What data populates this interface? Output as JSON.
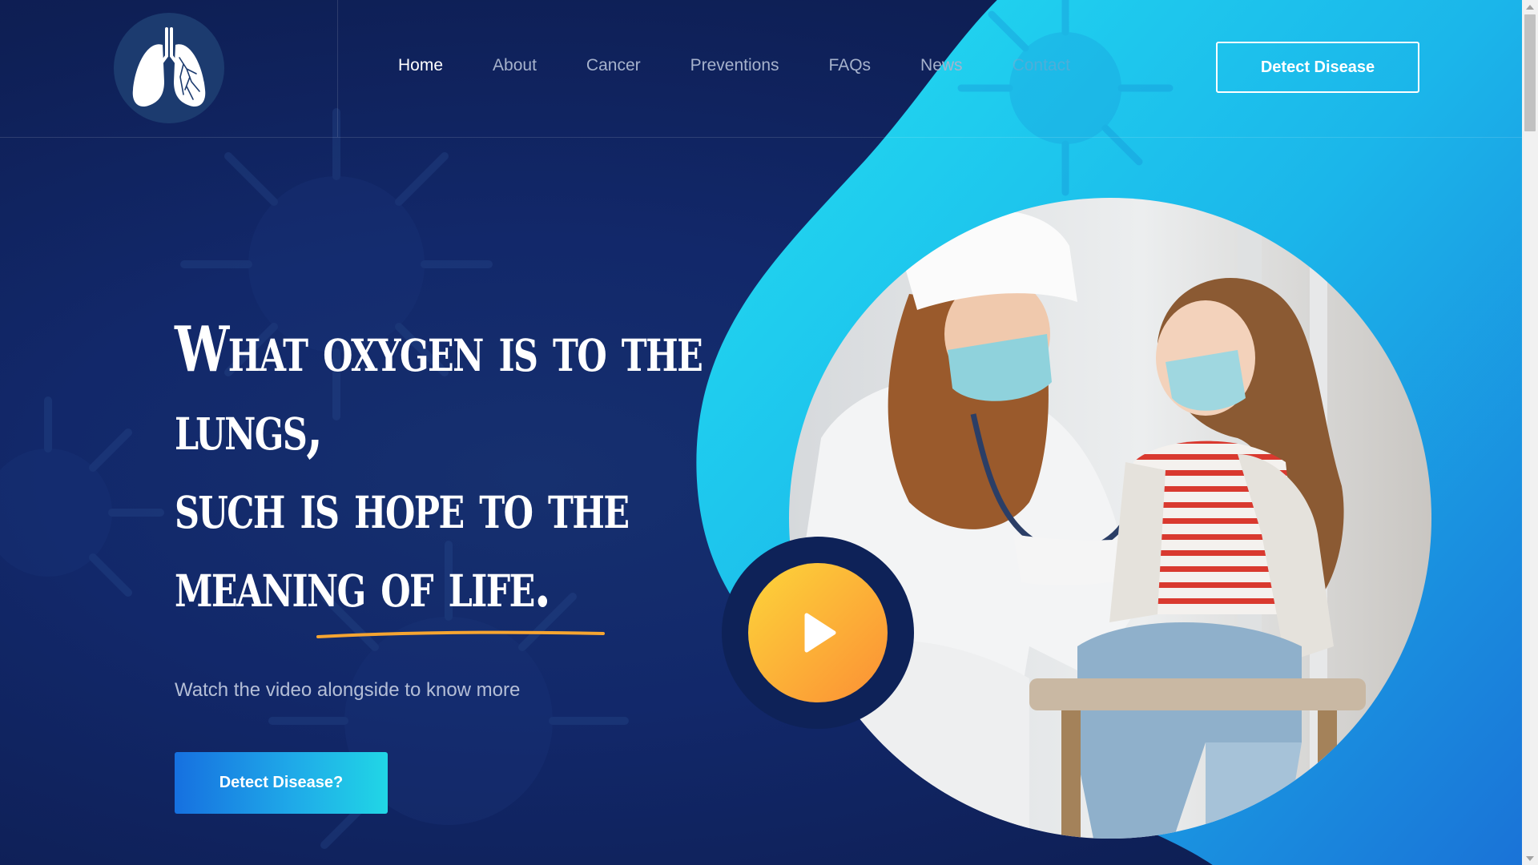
{
  "brand": {
    "logo_icon": "lungs-icon"
  },
  "nav": {
    "items": [
      {
        "label": "Home"
      },
      {
        "label": "About"
      },
      {
        "label": "Cancer"
      },
      {
        "label": "Preventions"
      },
      {
        "label": "FAQs"
      },
      {
        "label": "News"
      },
      {
        "label": "Contact"
      }
    ],
    "active": "Home"
  },
  "header": {
    "cta_label": "Detect Disease"
  },
  "hero": {
    "title_lines": [
      "What oxygen is to the",
      "lungs,",
      "such is hope to the",
      "meaning of life."
    ],
    "subtitle": "Watch the video alongside to know more",
    "cta_label": "Detect Disease?",
    "play_icon": "play-icon",
    "image": "doctor-examining-child-photo"
  },
  "colors": {
    "background": "#0f2257",
    "accent_cyan": "#21d6e6",
    "accent_blue": "#1670e0",
    "play_gradient_start": "#fdd53a",
    "play_gradient_end": "#fb8f35",
    "underline": "#f6a531"
  }
}
